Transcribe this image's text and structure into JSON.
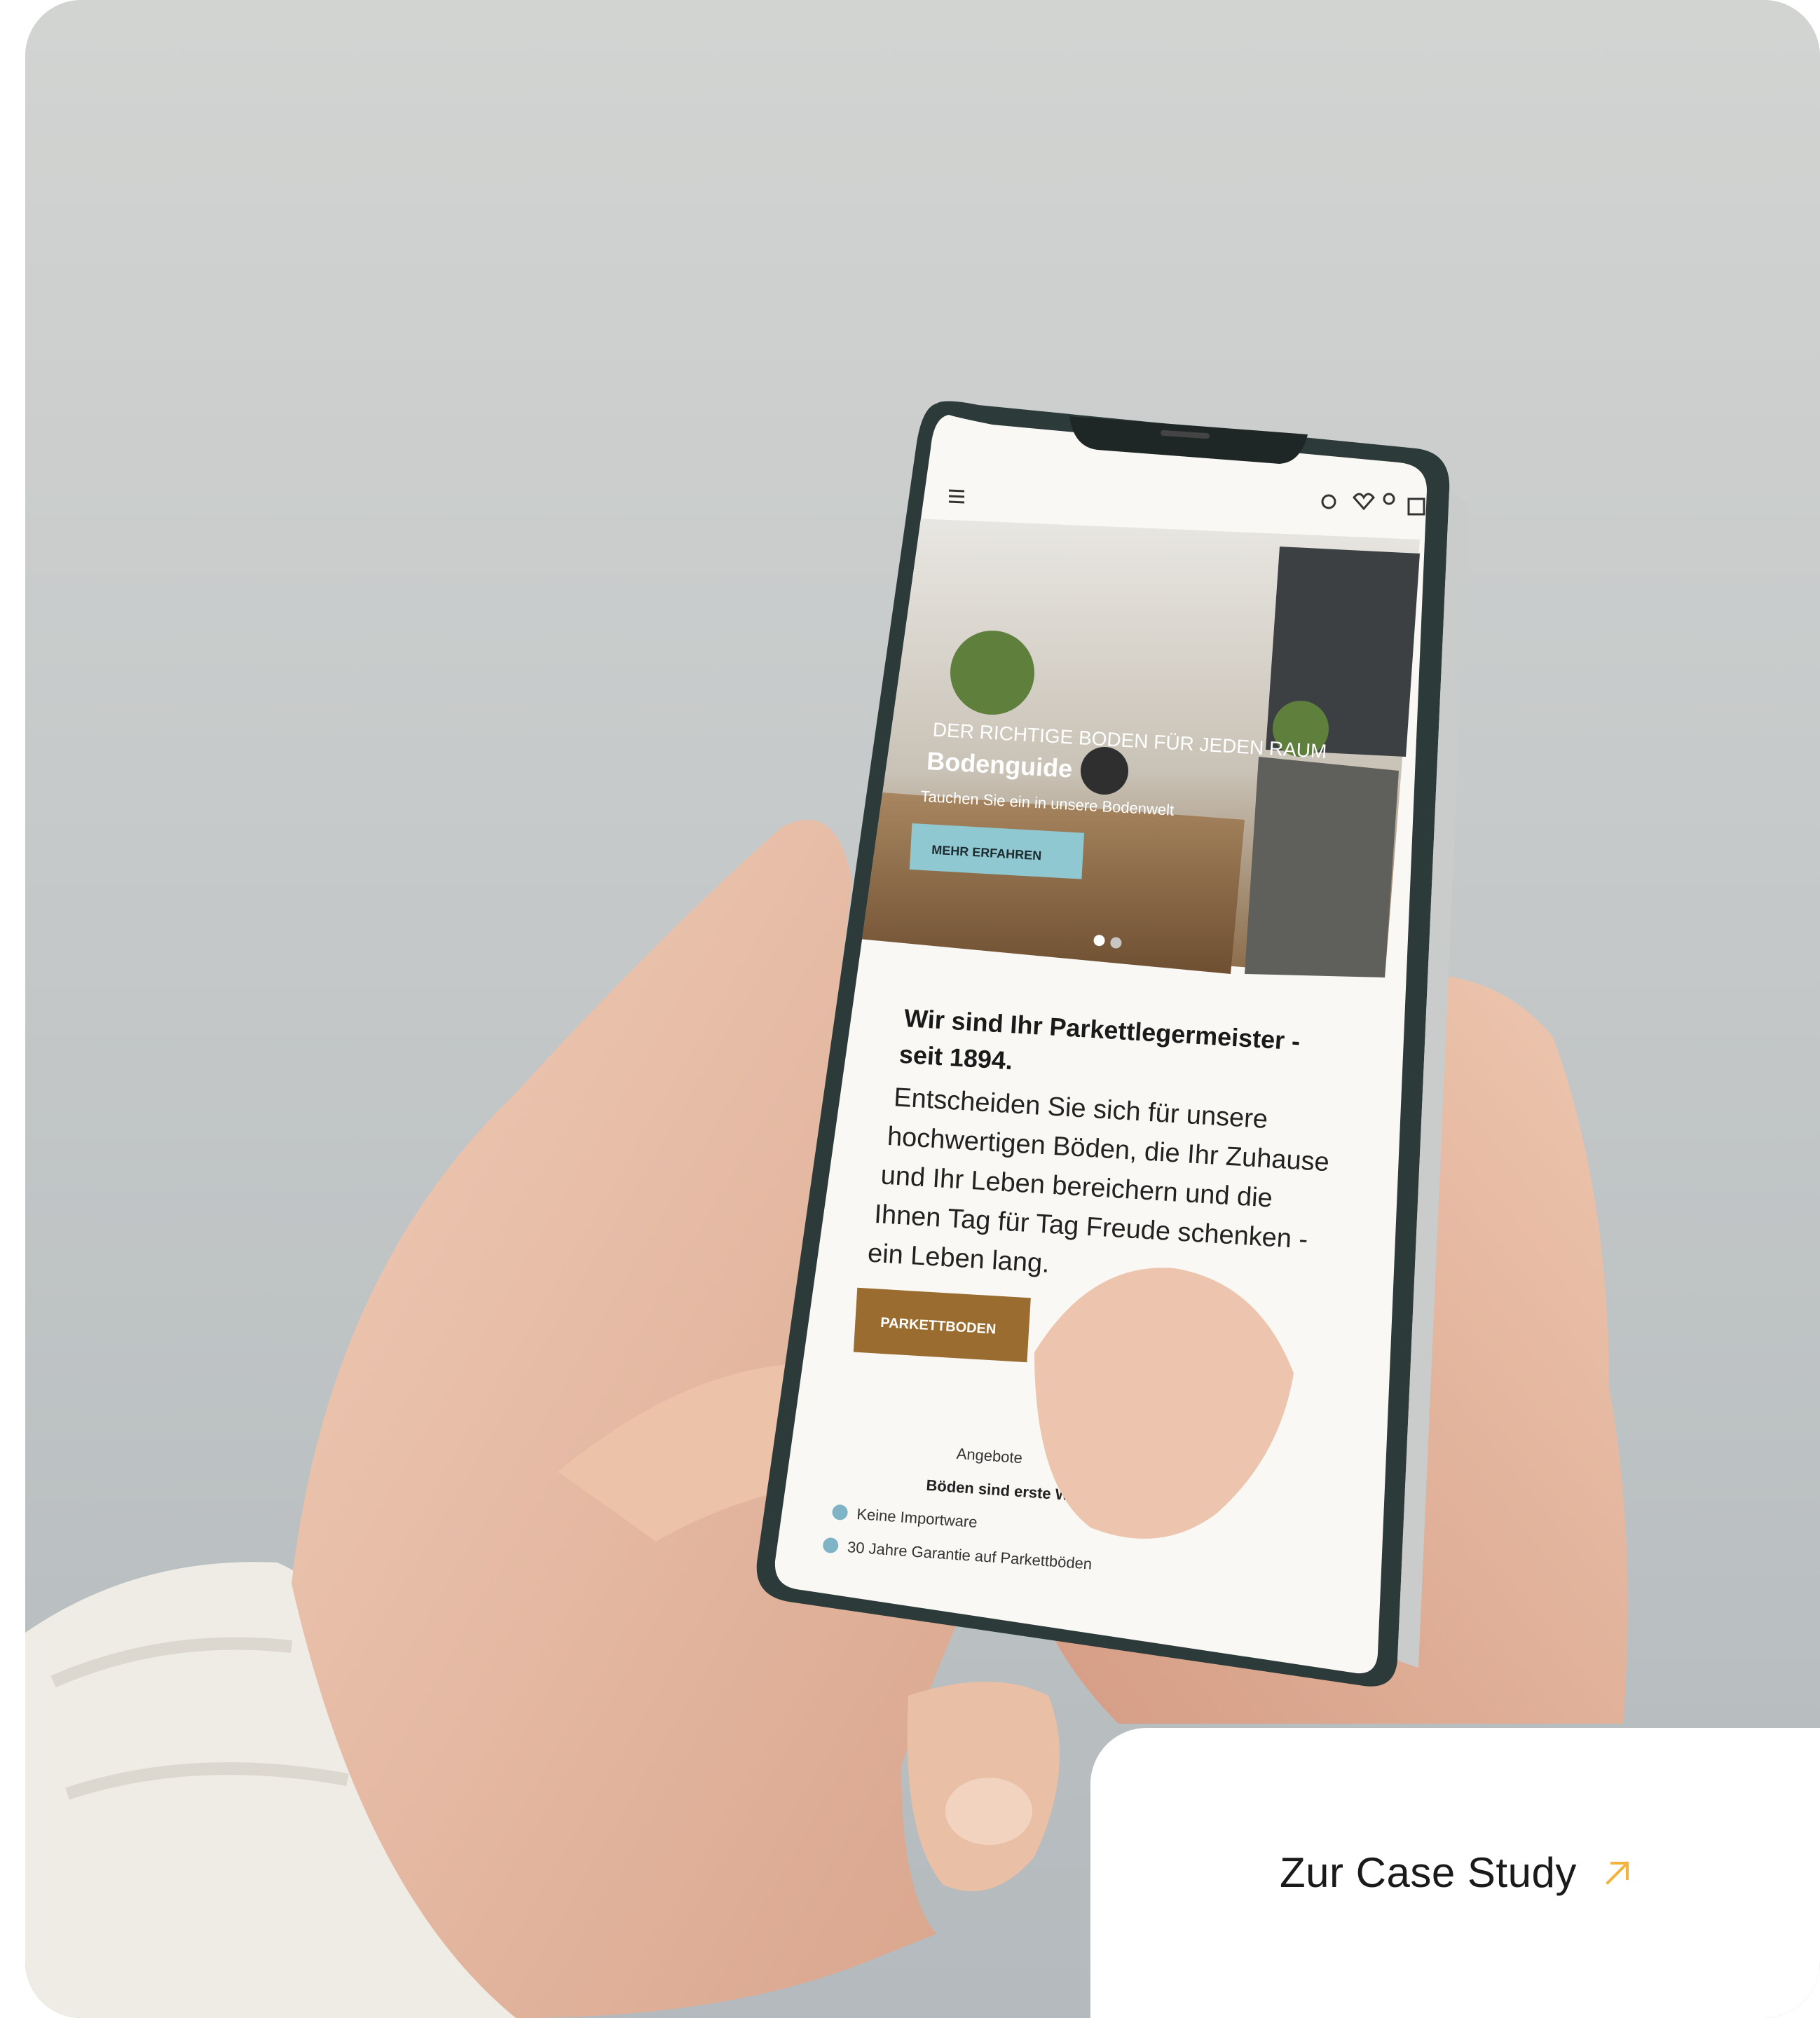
{
  "photo": {
    "subject": "hand-holding-smartphone",
    "site": {
      "hero": {
        "kicker": "DER RICHTIGE BODEN FÜR JEDEN RAUM",
        "title": "Bodenguide",
        "subtitle": "Tauchen Sie ein in unsere Bodenwelt",
        "button": "MEHR ERFAHREN"
      },
      "intro": {
        "heading_line1": "Wir sind Ihr Parkettlegermeister -",
        "heading_line2": "seit 1894.",
        "body_lines": [
          "Entscheiden Sie sich für unsere",
          "hochwertigen Böden, die Ihr Zuhause",
          "und Ihr Leben bereichern und die",
          "Ihnen Tag für Tag Freude schenken -",
          "ein Leben lang."
        ]
      },
      "primary_button": "PARKETTBODEN",
      "benefits": [
        "Angebote",
        "Böden sind erste Wahl",
        "Keine Importware",
        "30 Jahre Garantie auf Parkettböden"
      ],
      "colors": {
        "brand_brown": "#9a6c2f",
        "hero_button": "#8fc8d0",
        "check": "#7fb3c6"
      }
    }
  },
  "cta": {
    "label": "Zur Case Study",
    "arrow_color": "#f3b33d"
  }
}
